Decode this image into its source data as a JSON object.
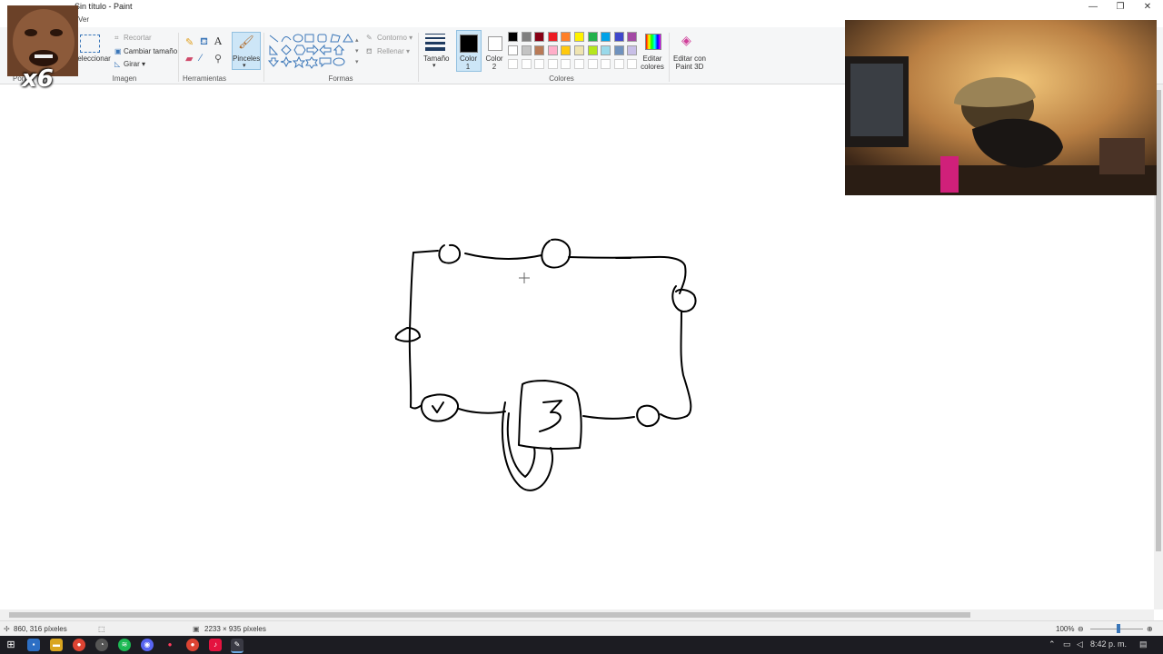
{
  "window": {
    "title": "Sin título - Paint",
    "controls": [
      "—",
      "❐",
      "✕"
    ]
  },
  "tabs": {
    "active_fragment": "Ver"
  },
  "ribbon": {
    "image_group": {
      "label": "Imagen",
      "select_label": "Seleccionar",
      "crop_label": "Recortar",
      "resize_label": "Cambiar tamaño",
      "rotate_label": "Girar ▾",
      "clipboard_fragment": "Port"
    },
    "tools_group": {
      "label": "Herramientas",
      "text_icon_glyph": "A"
    },
    "brushes": {
      "label": "Pinceles"
    },
    "shapes_group": {
      "label": "Formas",
      "outline_label": "Contorno ▾",
      "fill_label": "Rellenar ▾"
    },
    "size": {
      "label": "Tamaño"
    },
    "color1": {
      "label": "Color 1",
      "value": "#000000"
    },
    "color2": {
      "label": "Color 2",
      "value": "#ffffff"
    },
    "colors_group": {
      "label": "Colores",
      "row1": [
        "#000000",
        "#7f7f7f",
        "#880015",
        "#ed1c24",
        "#ff7f27",
        "#fff200",
        "#22b14c",
        "#00a2e8",
        "#3f48cc",
        "#a349a4"
      ],
      "row2": [
        "#ffffff",
        "#c3c3c3",
        "#b97a57",
        "#ffaec9",
        "#ffc90e",
        "#efe4b0",
        "#b5e61d",
        "#99d9ea",
        "#7092be",
        "#c8bfe7"
      ]
    },
    "edit_colors_label": "Editar colores",
    "paint3d_label": "Editar con Paint 3D"
  },
  "overlay": {
    "multiplier_text": "x6"
  },
  "canvas": {
    "drawing_labels": {
      "circle_bottom_left": "J",
      "square_center": "3"
    }
  },
  "statusbar": {
    "cursor_pos": "860, 316 píxeles",
    "canvas_size": "2233 × 935 píxeles",
    "zoom": "100%"
  },
  "taskbar": {
    "time": "8:42 p. m."
  }
}
